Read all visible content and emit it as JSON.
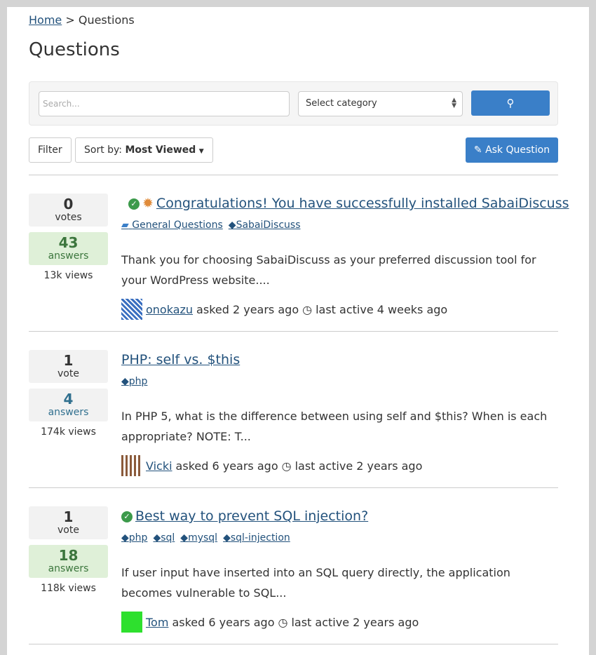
{
  "breadcrumb": {
    "home": "Home",
    "sep": ">",
    "current": "Questions"
  },
  "page_title": "Questions",
  "search": {
    "placeholder": "Search...",
    "category": "Select category"
  },
  "toolbar": {
    "filter": "Filter",
    "sort_prefix": "Sort by:",
    "sort_value": "Most Viewed",
    "ask": "Ask Question"
  },
  "questions": [
    {
      "votes": "0",
      "votes_label": "votes",
      "answers": "43",
      "answers_label": "answers",
      "views": "13k views",
      "title": "Congratulations! You have successfully installed SabaiDiscuss",
      "category": "General Questions",
      "tags": [
        "SabaiDiscuss"
      ],
      "excerpt": "Thank you for choosing SabaiDiscuss as your preferred discussion tool for your WordPress website....",
      "user": "onokazu",
      "asked": "asked 2 years ago",
      "active": "last active 4 weeks ago",
      "avatar_color": "#3a6fc0"
    },
    {
      "votes": "1",
      "votes_label": "vote",
      "answers": "4",
      "answers_label": "answers",
      "views": "174k views",
      "title": "PHP: self vs. $this",
      "tags": [
        "php"
      ],
      "excerpt": "In PHP 5, what is the difference between using self and $this? When is each appropriate? NOTE: T...",
      "user": "Vicki",
      "asked": "asked 6 years ago",
      "active": "last active 2 years ago",
      "avatar_color": "#8a5a3a"
    },
    {
      "votes": "1",
      "votes_label": "vote",
      "answers": "18",
      "answers_label": "answers",
      "views": "118k views",
      "title": "Best way to prevent SQL injection?",
      "tags": [
        "php",
        "sql",
        "mysql",
        "sql-injection"
      ],
      "excerpt": "If user input have inserted into an SQL query directly, the application becomes vulnerable to SQL...",
      "user": "Tom",
      "asked": "asked 6 years ago",
      "active": "last active 2 years ago",
      "avatar_color": "#2ee02e"
    }
  ]
}
